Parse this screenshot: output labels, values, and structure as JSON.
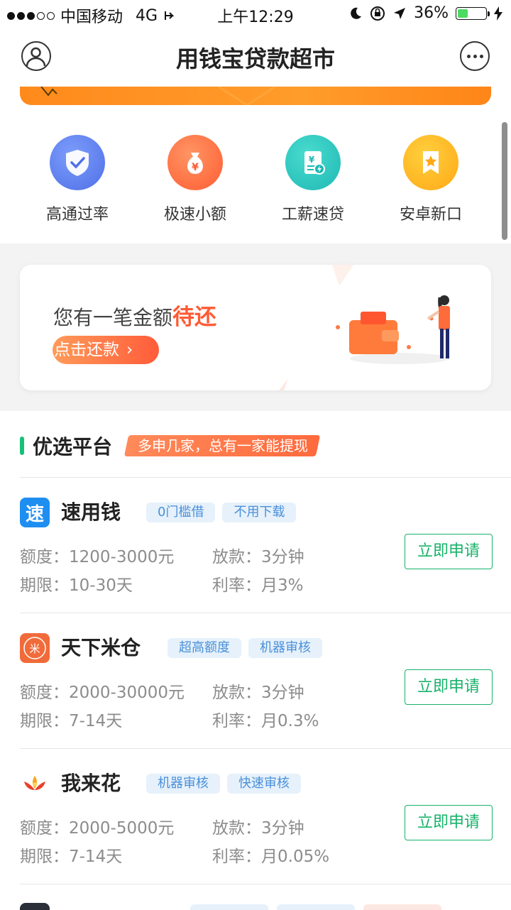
{
  "status_bar": {
    "carrier": "中国移动",
    "network": "4G",
    "time": "上午12:29",
    "battery": "36%",
    "battery_level": 0.36,
    "signal_bars_full": 3,
    "signal_bars_total": 5
  },
  "nav": {
    "title": "用钱宝贷款超市",
    "avatar_icon": "user-avatar-icon",
    "more_icon": "more-dots-icon"
  },
  "categories": [
    {
      "label": "高通过率",
      "icon": "shield-check-icon",
      "color": "#5b7ff0"
    },
    {
      "label": "极速小额",
      "icon": "money-bag-icon",
      "color": "#ff6a3a"
    },
    {
      "label": "工薪速贷",
      "icon": "bill-icon",
      "color": "#2bc5c0"
    },
    {
      "label": "安卓新口",
      "icon": "star-bookmark-icon",
      "color": "#ffb21e"
    }
  ],
  "repay": {
    "text": "您有一笔金额",
    "highlight": "待还",
    "button": "点击还款"
  },
  "section": {
    "title": "优选平台",
    "tag": "多申几家，总有一家能提现"
  },
  "products": [
    {
      "name": "速用钱",
      "logo_char": "速",
      "logo_color": "#1f8ef1",
      "tags": [
        "0门槛借",
        "不用下载"
      ],
      "amount_label": "额度：",
      "amount": "1200-3000元",
      "term_label": "期限：",
      "term": "10-30天",
      "loan_label": "放款：",
      "loan_time": "3分钟",
      "rate_label": "利率：",
      "rate": "月3%",
      "apply": "立即申请"
    },
    {
      "name": "天下米仓",
      "logo_char": "米",
      "logo_color": "#f16b3a",
      "tags": [
        "超高额度",
        "机器审核"
      ],
      "amount_label": "额度：",
      "amount": "2000-30000元",
      "term_label": "期限：",
      "term": "7-14天",
      "loan_label": "放款：",
      "loan_time": "3分钟",
      "rate_label": "利率：",
      "rate": "月0.3%",
      "apply": "立即申请"
    },
    {
      "name": "我来花",
      "logo_char": "",
      "logo_color": "#f5a623",
      "tags": [
        "机器审核",
        "快速审核"
      ],
      "amount_label": "额度：",
      "amount": "2000-5000元",
      "term_label": "期限：",
      "term": "7-14天",
      "loan_label": "放款：",
      "loan_time": "3分钟",
      "rate_label": "利率：",
      "rate": "月0.05%",
      "apply": "立即申请"
    }
  ]
}
